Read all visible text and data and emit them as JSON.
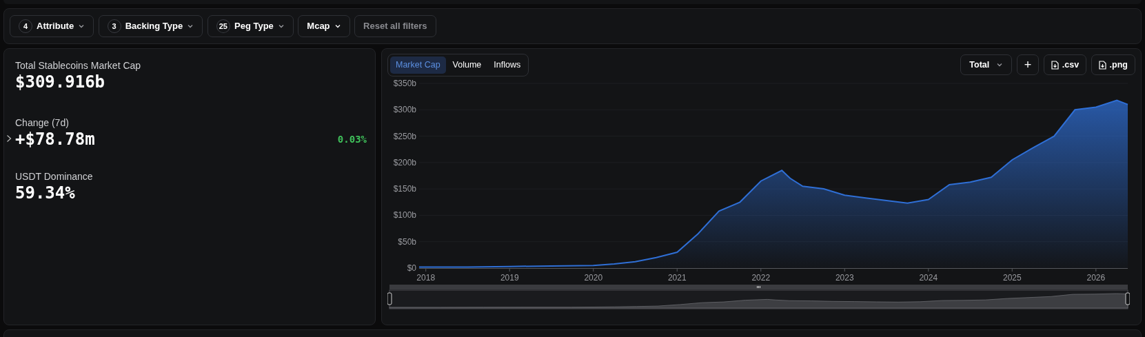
{
  "filters": [
    {
      "count": "4",
      "label": "Attribute",
      "kind": "dropdown"
    },
    {
      "count": "3",
      "label": "Backing Type",
      "kind": "dropdown"
    },
    {
      "count": "25",
      "label": "Peg Type",
      "kind": "dropdown"
    },
    {
      "label": "Mcap",
      "kind": "dropdown"
    },
    {
      "label": "Reset all filters",
      "kind": "reset",
      "disabled": true
    }
  ],
  "stats": [
    {
      "label": "Total Stablecoins Market Cap",
      "value": "$309.916b"
    },
    {
      "label": "Change (7d)",
      "value": "+$78.78m",
      "percent": "0.03%",
      "expandable": true
    },
    {
      "label": "USDT Dominance",
      "value": "59.34%"
    }
  ],
  "chart_tabs": [
    {
      "label": "Market Cap",
      "selected": true
    },
    {
      "label": "Volume",
      "selected": false
    },
    {
      "label": "Inflows",
      "selected": false
    }
  ],
  "chart_controls": {
    "dropdown": "Total",
    "buttons": [
      {
        "kind": "add",
        "label": "+"
      },
      {
        "kind": "download",
        "label": ".csv"
      },
      {
        "kind": "download",
        "label": ".png"
      }
    ]
  },
  "chart_data": {
    "type": "area",
    "x": [
      2017.92,
      2018.5,
      2019,
      2019.5,
      2020,
      2020.25,
      2020.5,
      2020.75,
      2021,
      2021.25,
      2021.5,
      2021.75,
      2022,
      2022.25,
      2022.35,
      2022.5,
      2022.75,
      2023,
      2023.25,
      2023.5,
      2023.75,
      2024,
      2024.25,
      2024.5,
      2024.75,
      2025,
      2025.25,
      2025.5,
      2025.75,
      2026,
      2026.25,
      2026.38
    ],
    "grid": true,
    "series": [
      {
        "color": "#2f6fd6",
        "values": [
          2,
          2,
          3,
          4,
          5,
          8,
          12,
          20,
          30,
          65,
          108,
          125,
          165,
          185,
          170,
          155,
          150,
          138,
          133,
          128,
          123,
          130,
          158,
          163,
          172,
          205,
          228,
          250,
          300,
          305,
          318,
          310
        ]
      }
    ],
    "xlim": [
      2017.92,
      2026.38
    ],
    "ylim": [
      0,
      350
    ],
    "xticks": [
      2018,
      2019,
      2020,
      2021,
      2022,
      2023,
      2024,
      2025,
      2026
    ],
    "yticks": [
      {
        "value": 0,
        "label": "$0"
      },
      {
        "value": 50,
        "label": "$50b"
      },
      {
        "value": 100,
        "label": "$100b"
      },
      {
        "value": 150,
        "label": "$150b"
      },
      {
        "value": 200,
        "label": "$200b"
      },
      {
        "value": 250,
        "label": "$250b"
      },
      {
        "value": 300,
        "label": "$300b"
      },
      {
        "value": 350,
        "label": "$350b"
      }
    ]
  }
}
